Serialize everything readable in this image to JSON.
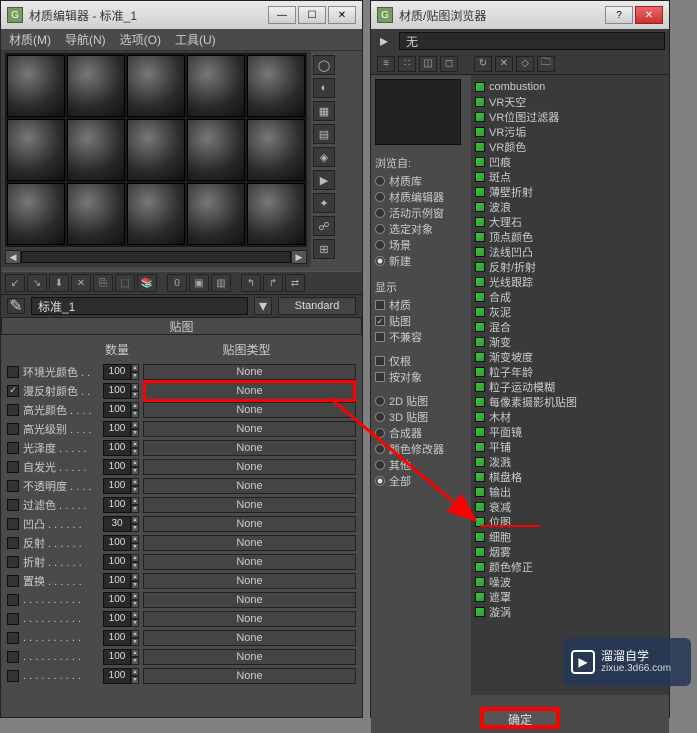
{
  "left_window": {
    "title": "材质编辑器 - 标准_1",
    "menu": [
      "材质(M)",
      "导航(N)",
      "选项(O)",
      "工具(U)"
    ],
    "material_name": "标准_1",
    "type_button": "Standard",
    "rollout_title": "贴图",
    "head_amount": "数量",
    "head_maptype": "贴图类型",
    "params": [
      {
        "label": "环境光颜色 . .",
        "value": "100",
        "map": "None",
        "checked": false
      },
      {
        "label": "漫反射颜色 . .",
        "value": "100",
        "map": "None",
        "checked": true,
        "highlight": true
      },
      {
        "label": "高光颜色 . . . .",
        "value": "100",
        "map": "None",
        "checked": false
      },
      {
        "label": "高光级别 . . . .",
        "value": "100",
        "map": "None",
        "checked": false
      },
      {
        "label": "光泽度 . . . . .",
        "value": "100",
        "map": "None",
        "checked": false
      },
      {
        "label": "自发光 . . . . .",
        "value": "100",
        "map": "None",
        "checked": false
      },
      {
        "label": "不透明度 . . . .",
        "value": "100",
        "map": "None",
        "checked": false
      },
      {
        "label": "过滤色 . . . . .",
        "value": "100",
        "map": "None",
        "checked": false
      },
      {
        "label": "凹凸 . . . . . .",
        "value": "30",
        "map": "None",
        "checked": false
      },
      {
        "label": "反射 . . . . . .",
        "value": "100",
        "map": "None",
        "checked": false
      },
      {
        "label": "折射 . . . . . .",
        "value": "100",
        "map": "None",
        "checked": false
      },
      {
        "label": "置换 . . . . . .",
        "value": "100",
        "map": "None",
        "checked": false
      },
      {
        "label": ". . . . . . . . . .",
        "value": "100",
        "map": "None",
        "checked": false
      },
      {
        "label": ". . . . . . . . . .",
        "value": "100",
        "map": "None",
        "checked": false
      },
      {
        "label": ". . . . . . . . . .",
        "value": "100",
        "map": "None",
        "checked": false
      },
      {
        "label": ". . . . . . . . . .",
        "value": "100",
        "map": "None",
        "checked": false
      },
      {
        "label": ". . . . . . . . . .",
        "value": "100",
        "map": "None",
        "checked": false
      }
    ]
  },
  "right_window": {
    "title": "材质/贴图浏览器",
    "search_value": "无",
    "browse_from_label": "浏览自:",
    "browse_from": [
      {
        "label": "材质库",
        "sel": false
      },
      {
        "label": "材质编辑器",
        "sel": false
      },
      {
        "label": "活动示例窗",
        "sel": false
      },
      {
        "label": "选定对象",
        "sel": false
      },
      {
        "label": "场景",
        "sel": false
      },
      {
        "label": "新建",
        "sel": true
      }
    ],
    "show_label": "显示",
    "show": [
      {
        "label": "材质",
        "sel": false
      },
      {
        "label": "贴图",
        "sel": true
      },
      {
        "label": "不兼容",
        "sel": false
      }
    ],
    "root": [
      {
        "label": "仅根",
        "sel": false
      },
      {
        "label": "按对象",
        "sel": false
      }
    ],
    "filter": [
      {
        "label": "2D 贴图",
        "sel": false
      },
      {
        "label": "3D 贴图",
        "sel": false
      },
      {
        "label": "合成器",
        "sel": false
      },
      {
        "label": "颜色修改器",
        "sel": false
      },
      {
        "label": "其他",
        "sel": false
      },
      {
        "label": "全部",
        "sel": true
      }
    ],
    "maps": [
      "combustion",
      "VR天空",
      "VR位图过滤器",
      "VR污垢",
      "VR颜色",
      "凹痕",
      "斑点",
      "薄壁折射",
      "波浪",
      "大理石",
      "顶点颜色",
      "法线凹凸",
      "反射/折射",
      "光线跟踪",
      "合成",
      "灰泥",
      "混合",
      "渐变",
      "渐变坡度",
      "粒子年龄",
      "粒子运动模糊",
      "每像素摄影机贴图",
      "木材",
      "平面镜",
      "平铺",
      "泼溅",
      "棋盘格",
      "输出",
      "衰减",
      "位图",
      "细胞",
      "烟雾",
      "颜色修正",
      "噪波",
      "遮罩",
      "漩涡"
    ],
    "ok": "确定"
  },
  "watermark": {
    "brand": "溜溜自学",
    "url": "zixue.3d66.com"
  }
}
